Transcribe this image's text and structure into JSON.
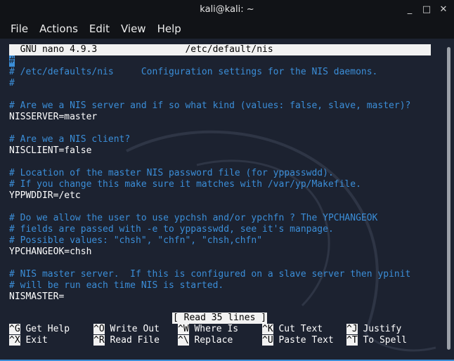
{
  "window": {
    "title": "kali@kali: ~"
  },
  "window_controls": {
    "minimize": "_",
    "maximize": "□",
    "close": "✕"
  },
  "menu": [
    "File",
    "Actions",
    "Edit",
    "View",
    "Help"
  ],
  "nano": {
    "header": "  GNU nano 4.9.3                /etc/default/nis",
    "cursor_char": "#",
    "lines": [
      {
        "text": "",
        "type": "comment"
      },
      {
        "text": "# /etc/defaults/nis     Configuration settings for the NIS daemons.",
        "type": "comment"
      },
      {
        "text": "#",
        "type": "comment"
      },
      {
        "text": "",
        "type": "blank"
      },
      {
        "text": "# Are we a NIS server and if so what kind (values: false, slave, master)?",
        "type": "comment"
      },
      {
        "text": "NISSERVER=master",
        "type": "code"
      },
      {
        "text": "",
        "type": "blank"
      },
      {
        "text": "# Are we a NIS client?",
        "type": "comment"
      },
      {
        "text": "NISCLIENT=false",
        "type": "code"
      },
      {
        "text": "",
        "type": "blank"
      },
      {
        "text": "# Location of the master NIS password file (for yppasswdd).",
        "type": "comment"
      },
      {
        "text": "# If you change this make sure it matches with /var/yp/Makefile.",
        "type": "comment"
      },
      {
        "text": "YPPWDDIR=/etc",
        "type": "code"
      },
      {
        "text": "",
        "type": "blank"
      },
      {
        "text": "# Do we allow the user to use ypchsh and/or ypchfn ? The YPCHANGEOK",
        "type": "comment"
      },
      {
        "text": "# fields are passed with -e to yppasswdd, see it's manpage.",
        "type": "comment"
      },
      {
        "text": "# Possible values: \"chsh\", \"chfn\", \"chsh,chfn\"",
        "type": "comment"
      },
      {
        "text": "YPCHANGEOK=chsh",
        "type": "code"
      },
      {
        "text": "",
        "type": "blank"
      },
      {
        "text": "# NIS master server.  If this is configured on a slave server then ypinit",
        "type": "comment"
      },
      {
        "text": "# will be run each time NIS is started.",
        "type": "comment"
      },
      {
        "text": "NISMASTER=",
        "type": "code"
      }
    ],
    "status": "[ Read 35 lines ]",
    "shortcuts_row1": [
      {
        "key": "^G",
        "label": "Get Help"
      },
      {
        "key": "^O",
        "label": "Write Out"
      },
      {
        "key": "^W",
        "label": "Where Is"
      },
      {
        "key": "^K",
        "label": "Cut Text"
      },
      {
        "key": "^J",
        "label": "Justify"
      }
    ],
    "shortcuts_row2": [
      {
        "key": "^X",
        "label": "Exit"
      },
      {
        "key": "^R",
        "label": "Read File"
      },
      {
        "key": "^\\",
        "label": "Replace"
      },
      {
        "key": "^U",
        "label": "Paste Text"
      },
      {
        "key": "^T",
        "label": "To Spell"
      }
    ]
  },
  "colors": {
    "background": "#1c2230",
    "comment": "#3b8ed8",
    "text": "#ffffff",
    "bar": "#111317"
  }
}
